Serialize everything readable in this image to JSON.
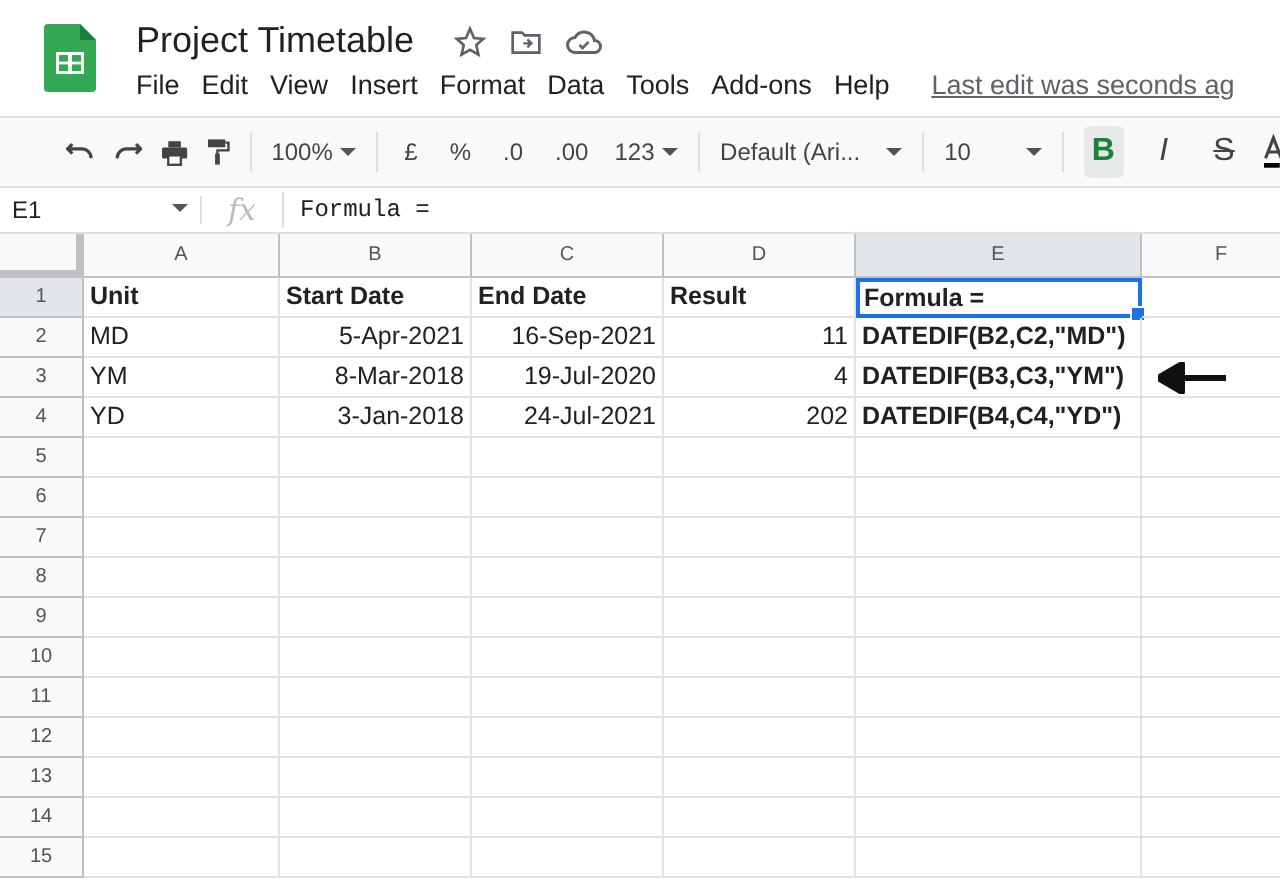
{
  "title": "Project Timetable",
  "menu": [
    "File",
    "Edit",
    "View",
    "Insert",
    "Format",
    "Data",
    "Tools",
    "Add-ons",
    "Help"
  ],
  "last_edit": "Last edit was seconds ag",
  "toolbar": {
    "zoom": "100%",
    "currency": "£",
    "percent": "%",
    "decrease_decimals": ".0",
    "increase_decimals": ".00",
    "number_format": "123",
    "font": "Default (Ari...",
    "font_size": "10",
    "styles": [
      {
        "label": "B",
        "kind": "bold",
        "selected": true
      },
      {
        "label": "I",
        "kind": "italic",
        "selected": false
      },
      {
        "label": "S",
        "kind": "strike",
        "selected": false
      }
    ]
  },
  "formula_bar": {
    "cell_ref": "E1",
    "fx": "fx",
    "content": "Formula ="
  },
  "columns": [
    {
      "label": "A",
      "right_aligned": false,
      "bold": false,
      "selected": false
    },
    {
      "label": "B",
      "right_aligned": true,
      "bold": false,
      "selected": false
    },
    {
      "label": "C",
      "right_aligned": true,
      "bold": false,
      "selected": false
    },
    {
      "label": "D",
      "right_aligned": true,
      "bold": false,
      "selected": false
    },
    {
      "label": "E",
      "right_aligned": false,
      "bold": true,
      "selected": true
    },
    {
      "label": "F",
      "selected": false
    }
  ],
  "rows": [
    {
      "number": "1",
      "header": true,
      "selected": true,
      "cells": [
        "Unit",
        "Start Date",
        "End Date",
        "Result",
        "Formula ="
      ]
    },
    {
      "number": "2",
      "header": false,
      "selected": false,
      "cells": [
        "MD",
        "5-Apr-2021",
        "16-Sep-2021",
        "11",
        "DATEDIF(B2,C2,\"MD\")"
      ]
    },
    {
      "number": "3",
      "header": false,
      "selected": false,
      "arrow": true,
      "cells": [
        "YM",
        "8-Mar-2018",
        "19-Jul-2020",
        "4",
        "DATEDIF(B3,C3,\"YM\")"
      ]
    },
    {
      "number": "4",
      "header": false,
      "selected": false,
      "cells": [
        "YD",
        "3-Jan-2018",
        "24-Jul-2021",
        "202",
        "DATEDIF(B4,C4,\"YD\")"
      ]
    },
    {
      "number": "5",
      "selected": false,
      "cells": []
    },
    {
      "number": "6",
      "selected": false,
      "cells": []
    },
    {
      "number": "7",
      "selected": false,
      "cells": []
    },
    {
      "number": "8",
      "selected": false,
      "cells": []
    },
    {
      "number": "9",
      "selected": false,
      "cells": []
    },
    {
      "number": "10",
      "selected": false,
      "cells": []
    },
    {
      "number": "11",
      "selected": false,
      "cells": []
    },
    {
      "number": "12",
      "selected": false,
      "cells": []
    },
    {
      "number": "13",
      "selected": false,
      "cells": []
    },
    {
      "number": "14",
      "selected": false,
      "cells": []
    },
    {
      "number": "15",
      "selected": false,
      "cells": []
    }
  ]
}
